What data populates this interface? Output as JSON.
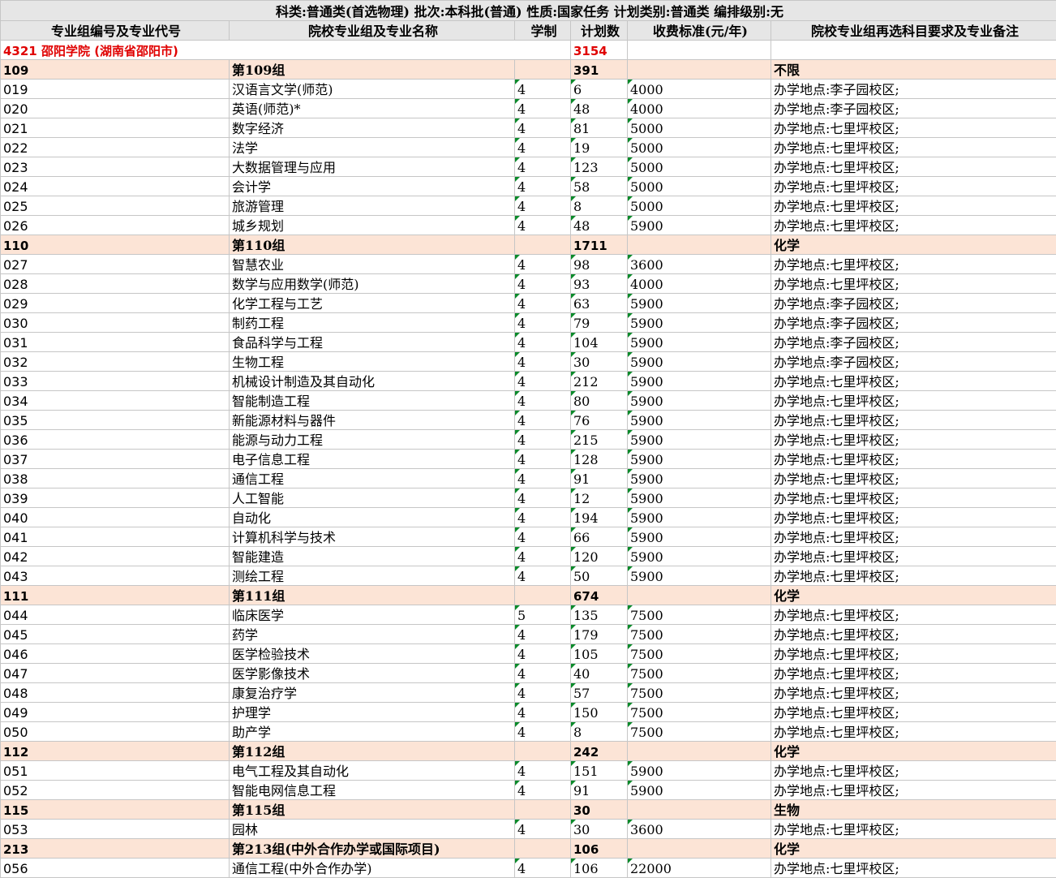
{
  "title": "科类:普通类(首选物理)  批次:本科批(普通)  性质:国家任务 计划类别:普通类 编排级别:无",
  "headers": [
    "专业组编号及专业代号",
    "院校专业组及专业名称",
    "学制",
    "计划数",
    "收费标准(元/年)",
    "院校专业组再选科目要求及专业备注"
  ],
  "school": {
    "code_name": "4321  邵阳学院  (湖南省邵阳市)",
    "plan": "3154"
  },
  "rows": [
    {
      "type": "group",
      "code": "109",
      "name": "第109组",
      "years": "",
      "plan": "391",
      "fee": "",
      "note": "不限"
    },
    {
      "type": "item",
      "code": "019",
      "name": "汉语言文学(师范)",
      "years": "4",
      "plan": "6",
      "fee": "4000",
      "note": "办学地点:李子园校区;"
    },
    {
      "type": "item",
      "code": "020",
      "name": "英语(师范)*",
      "years": "4",
      "plan": "48",
      "fee": "4000",
      "note": "办学地点:李子园校区;"
    },
    {
      "type": "item",
      "code": "021",
      "name": "数字经济",
      "years": "4",
      "plan": "81",
      "fee": "5000",
      "note": "办学地点:七里坪校区;"
    },
    {
      "type": "item",
      "code": "022",
      "name": "法学",
      "years": "4",
      "plan": "19",
      "fee": "5000",
      "note": "办学地点:七里坪校区;"
    },
    {
      "type": "item",
      "code": "023",
      "name": "大数据管理与应用",
      "years": "4",
      "plan": "123",
      "fee": "5000",
      "note": "办学地点:七里坪校区;"
    },
    {
      "type": "item",
      "code": "024",
      "name": "会计学",
      "years": "4",
      "plan": "58",
      "fee": "5000",
      "note": "办学地点:七里坪校区;"
    },
    {
      "type": "item",
      "code": "025",
      "name": "旅游管理",
      "years": "4",
      "plan": "8",
      "fee": "5000",
      "note": "办学地点:七里坪校区;"
    },
    {
      "type": "item",
      "code": "026",
      "name": "城乡规划",
      "years": "4",
      "plan": "48",
      "fee": "5900",
      "note": "办学地点:七里坪校区;"
    },
    {
      "type": "group",
      "code": "110",
      "name": "第110组",
      "years": "",
      "plan": "1711",
      "fee": "",
      "note": "化学"
    },
    {
      "type": "item",
      "code": "027",
      "name": "智慧农业",
      "years": "4",
      "plan": "98",
      "fee": "3600",
      "note": "办学地点:七里坪校区;"
    },
    {
      "type": "item",
      "code": "028",
      "name": "数学与应用数学(师范)",
      "years": "4",
      "plan": "93",
      "fee": "4000",
      "note": "办学地点:七里坪校区;"
    },
    {
      "type": "item",
      "code": "029",
      "name": "化学工程与工艺",
      "years": "4",
      "plan": "63",
      "fee": "5900",
      "note": "办学地点:李子园校区;"
    },
    {
      "type": "item",
      "code": "030",
      "name": "制药工程",
      "years": "4",
      "plan": "79",
      "fee": "5900",
      "note": "办学地点:李子园校区;"
    },
    {
      "type": "item",
      "code": "031",
      "name": "食品科学与工程",
      "years": "4",
      "plan": "104",
      "fee": "5900",
      "note": "办学地点:李子园校区;"
    },
    {
      "type": "item",
      "code": "032",
      "name": "生物工程",
      "years": "4",
      "plan": "30",
      "fee": "5900",
      "note": "办学地点:李子园校区;"
    },
    {
      "type": "item",
      "code": "033",
      "name": "机械设计制造及其自动化",
      "years": "4",
      "plan": "212",
      "fee": "5900",
      "note": "办学地点:七里坪校区;"
    },
    {
      "type": "item",
      "code": "034",
      "name": "智能制造工程",
      "years": "4",
      "plan": "80",
      "fee": "5900",
      "note": "办学地点:七里坪校区;"
    },
    {
      "type": "item",
      "code": "035",
      "name": "新能源材料与器件",
      "years": "4",
      "plan": "76",
      "fee": "5900",
      "note": "办学地点:七里坪校区;"
    },
    {
      "type": "item",
      "code": "036",
      "name": "能源与动力工程",
      "years": "4",
      "plan": "215",
      "fee": "5900",
      "note": "办学地点:七里坪校区;"
    },
    {
      "type": "item",
      "code": "037",
      "name": "电子信息工程",
      "years": "4",
      "plan": "128",
      "fee": "5900",
      "note": "办学地点:七里坪校区;"
    },
    {
      "type": "item",
      "code": "038",
      "name": "通信工程",
      "years": "4",
      "plan": "91",
      "fee": "5900",
      "note": "办学地点:七里坪校区;"
    },
    {
      "type": "item",
      "code": "039",
      "name": "人工智能",
      "years": "4",
      "plan": "12",
      "fee": "5900",
      "note": "办学地点:七里坪校区;"
    },
    {
      "type": "item",
      "code": "040",
      "name": "自动化",
      "years": "4",
      "plan": "194",
      "fee": "5900",
      "note": "办学地点:七里坪校区;"
    },
    {
      "type": "item",
      "code": "041",
      "name": "计算机科学与技术",
      "years": "4",
      "plan": "66",
      "fee": "5900",
      "note": "办学地点:七里坪校区;"
    },
    {
      "type": "item",
      "code": "042",
      "name": "智能建造",
      "years": "4",
      "plan": "120",
      "fee": "5900",
      "note": "办学地点:七里坪校区;"
    },
    {
      "type": "item",
      "code": "043",
      "name": "测绘工程",
      "years": "4",
      "plan": "50",
      "fee": "5900",
      "note": "办学地点:七里坪校区;"
    },
    {
      "type": "group",
      "code": "111",
      "name": "第111组",
      "years": "",
      "plan": "674",
      "fee": "",
      "note": "化学"
    },
    {
      "type": "item",
      "code": "044",
      "name": "临床医学",
      "years": "5",
      "plan": "135",
      "fee": "7500",
      "note": "办学地点:七里坪校区;"
    },
    {
      "type": "item",
      "code": "045",
      "name": "药学",
      "years": "4",
      "plan": "179",
      "fee": "7500",
      "note": "办学地点:七里坪校区;"
    },
    {
      "type": "item",
      "code": "046",
      "name": "医学检验技术",
      "years": "4",
      "plan": "105",
      "fee": "7500",
      "note": "办学地点:七里坪校区;"
    },
    {
      "type": "item",
      "code": "047",
      "name": "医学影像技术",
      "years": "4",
      "plan": "40",
      "fee": "7500",
      "note": "办学地点:七里坪校区;"
    },
    {
      "type": "item",
      "code": "048",
      "name": "康复治疗学",
      "years": "4",
      "plan": "57",
      "fee": "7500",
      "note": "办学地点:七里坪校区;"
    },
    {
      "type": "item",
      "code": "049",
      "name": "护理学",
      "years": "4",
      "plan": "150",
      "fee": "7500",
      "note": "办学地点:七里坪校区;"
    },
    {
      "type": "item",
      "code": "050",
      "name": "助产学",
      "years": "4",
      "plan": "8",
      "fee": "7500",
      "note": "办学地点:七里坪校区;"
    },
    {
      "type": "group",
      "code": "112",
      "name": "第112组",
      "years": "",
      "plan": "242",
      "fee": "",
      "note": "化学"
    },
    {
      "type": "item",
      "code": "051",
      "name": "电气工程及其自动化",
      "years": "4",
      "plan": "151",
      "fee": "5900",
      "note": "办学地点:七里坪校区;"
    },
    {
      "type": "item",
      "code": "052",
      "name": "智能电网信息工程",
      "years": "4",
      "plan": "91",
      "fee": "5900",
      "note": "办学地点:七里坪校区;"
    },
    {
      "type": "group",
      "code": "115",
      "name": "第115组",
      "years": "",
      "plan": "30",
      "fee": "",
      "note": "生物"
    },
    {
      "type": "item",
      "code": "053",
      "name": "园林",
      "years": "4",
      "plan": "30",
      "fee": "3600",
      "note": "办学地点:七里坪校区;"
    },
    {
      "type": "group",
      "code": "213",
      "name": "第213组(中外合作办学或国际项目)",
      "years": "",
      "plan": "106",
      "fee": "",
      "note": "化学"
    },
    {
      "type": "item",
      "code": "056",
      "name": "通信工程(中外合作办学)",
      "years": "4",
      "plan": "106",
      "fee": "22000",
      "note": "办学地点:七里坪校区;"
    }
  ]
}
